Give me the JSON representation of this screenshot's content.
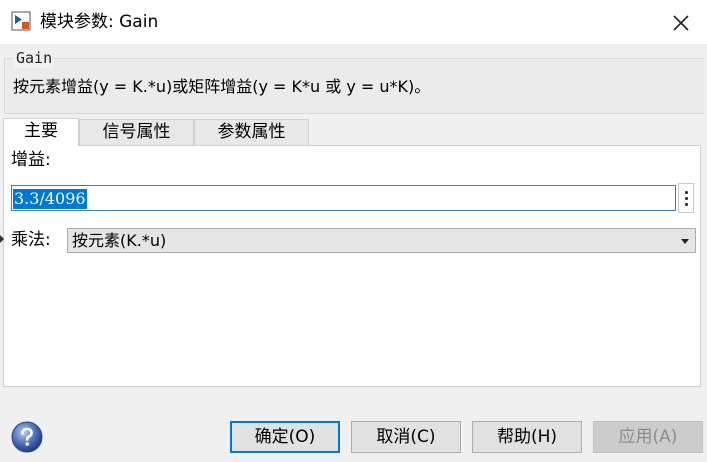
{
  "window": {
    "title": "模块参数: Gain",
    "close_icon": "close-icon",
    "app_icon": "simulink-block-icon"
  },
  "description": {
    "legend": "Gain",
    "text": "按元素增益(y = K.*u)或矩阵增益(y = K*u 或 y = u*K)。"
  },
  "tabs": [
    {
      "label": "主要",
      "active": true
    },
    {
      "label": "信号属性",
      "active": false
    },
    {
      "label": "参数属性",
      "active": false
    }
  ],
  "main": {
    "gain_label": "增益:",
    "gain_value": "3.3/4096",
    "more_icon": "vertical-ellipsis-icon",
    "multiplication_label": "乘法:",
    "multiplication_value": "按元素(K.*u)"
  },
  "buttons": {
    "ok": "确定(O)",
    "cancel": "取消(C)",
    "help": "帮助(H)",
    "apply": "应用(A)",
    "help_icon": "question-icon"
  },
  "colors": {
    "selection": "#0078d7",
    "input_focus_border": "#3c7fb1"
  }
}
